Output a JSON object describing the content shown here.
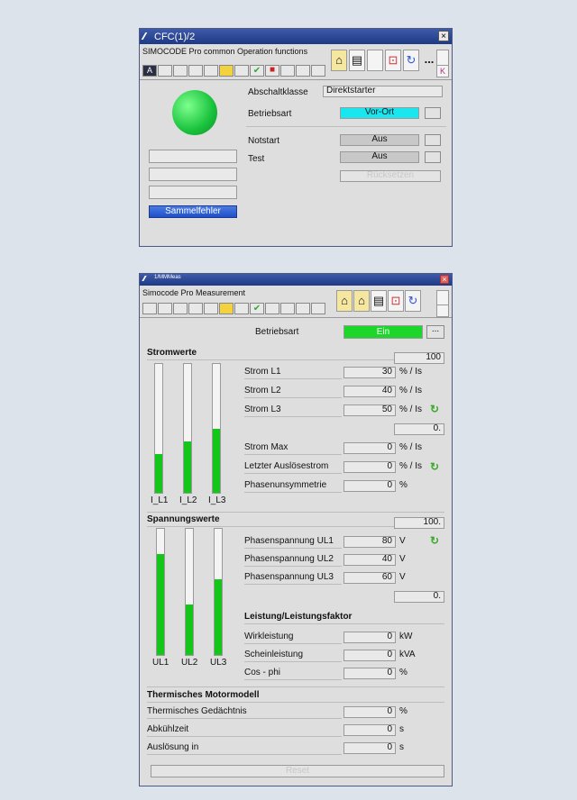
{
  "cfc": {
    "title": "CFC(1)/2",
    "close": "×",
    "subtitle": "SIMOCODE Pro common Operation functions",
    "tb_a": "A",
    "tb_check": "✔",
    "tb_red": "■",
    "menu_more": "...",
    "side_k": "K",
    "abschaltklasse_label": "Abschaltklasse",
    "abschaltklasse_value": "Direktstarter",
    "betriebsart_label": "Betriebsart",
    "betriebsart_value": "Vor-Ort",
    "notstart_label": "Notstart",
    "notstart_value": "Aus",
    "test_label": "Test",
    "test_value": "Aus",
    "disabled_btn": "Rücksetzen",
    "sammelfehler": "Sammelfehler"
  },
  "meas": {
    "title": "1/MMMeas",
    "close": "×",
    "subtitle": "Simocode Pro Measurement",
    "tb_check": "✔",
    "betriebsart_label": "Betriebsart",
    "betriebsart_value": "Ein",
    "dots": "...",
    "strom": {
      "section": "Stromwerte",
      "max_scale": "100",
      "min_scale": "0.",
      "rows": [
        {
          "label": "Strom L1",
          "value": "30",
          "unit": "% / Is"
        },
        {
          "label": "Strom L2",
          "value": "40",
          "unit": "% / Is"
        },
        {
          "label": "Strom L3",
          "value": "50",
          "unit": "% / Is"
        },
        {
          "label": "Strom Max",
          "value": "0",
          "unit": "% / Is"
        },
        {
          "label": "Letzter Auslösestrom",
          "value": "0",
          "unit": "% / Is"
        },
        {
          "label": "Phasenunsymmetrie",
          "value": "0",
          "unit": "%"
        }
      ],
      "bars": [
        {
          "label": "I_L1",
          "level": 30
        },
        {
          "label": "I_L2",
          "level": 40
        },
        {
          "label": "I_L3",
          "level": 50
        }
      ]
    },
    "spannung": {
      "section": "Spannungswerte",
      "max_scale": "100.",
      "min_scale": "0.",
      "rows": [
        {
          "label": "Phasenspannung UL1",
          "value": "80",
          "unit": "V"
        },
        {
          "label": "Phasenspannung UL2",
          "value": "40",
          "unit": "V"
        },
        {
          "label": "Phasenspannung UL3",
          "value": "60",
          "unit": "V"
        }
      ],
      "bars": [
        {
          "label": "UL1",
          "level": 80
        },
        {
          "label": "UL2",
          "level": 40
        },
        {
          "label": "UL3",
          "level": 60
        }
      ]
    },
    "leistung": {
      "section": "Leistung/Leistungsfaktor",
      "rows": [
        {
          "label": "Wirkleistung",
          "value": "0",
          "unit": "kW"
        },
        {
          "label": "Scheinleistung",
          "value": "0",
          "unit": "kVA"
        },
        {
          "label": "Cos - phi",
          "value": "0",
          "unit": "%"
        }
      ]
    },
    "thermisch": {
      "section": "Thermisches Motormodell",
      "rows": [
        {
          "label": "Thermisches Gedächtnis",
          "value": "0",
          "unit": "%"
        },
        {
          "label": "Abkühlzeit",
          "value": "0",
          "unit": "s"
        },
        {
          "label": "Auslösung in",
          "value": "0",
          "unit": "s"
        }
      ]
    },
    "reset_btn": "Reset"
  },
  "colors": {
    "green": "#14c51a",
    "cyan": "#19e6ef",
    "blue": "#1e4fc9",
    "titlebar": "#1e3a86"
  },
  "icons": [
    "home-icon",
    "list-icon",
    "chart-icon",
    "refresh-icon",
    "lock-icon",
    "check-icon"
  ]
}
